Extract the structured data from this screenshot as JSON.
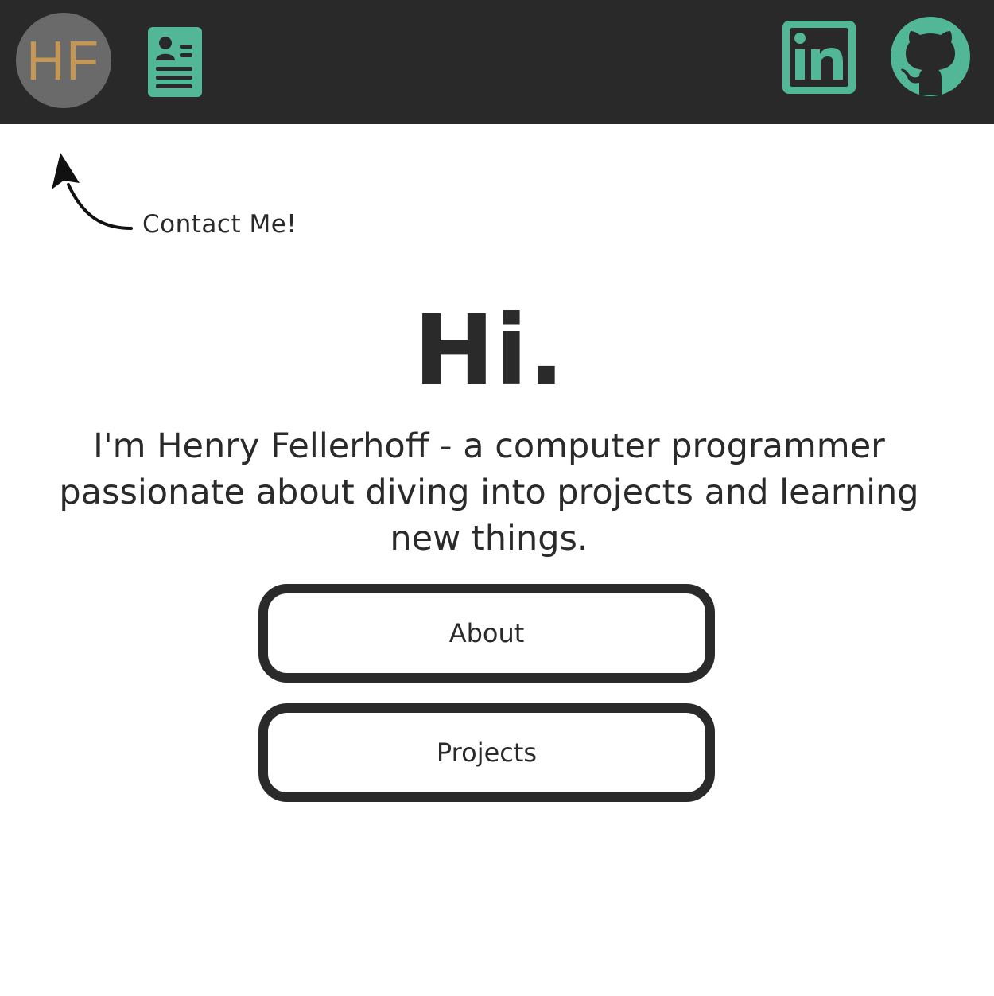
{
  "header": {
    "logo_text": "HF",
    "icons": {
      "resume": "contact-card-icon",
      "linkedin": "linkedin-icon",
      "github": "github-icon"
    },
    "colors": {
      "bar": "#292929",
      "accent": "#52b797",
      "logo_bg": "#6a6a6a",
      "logo_text": "#c99a57"
    }
  },
  "hint": {
    "text": "Contact Me!",
    "icon": "curved-arrow-icon"
  },
  "hero": {
    "title": "Hi.",
    "intro": "I'm Henry Fellerhoff - a computer programmer passionate about diving into projects and learning new things."
  },
  "nav": {
    "about_label": "About",
    "projects_label": "Projects"
  }
}
